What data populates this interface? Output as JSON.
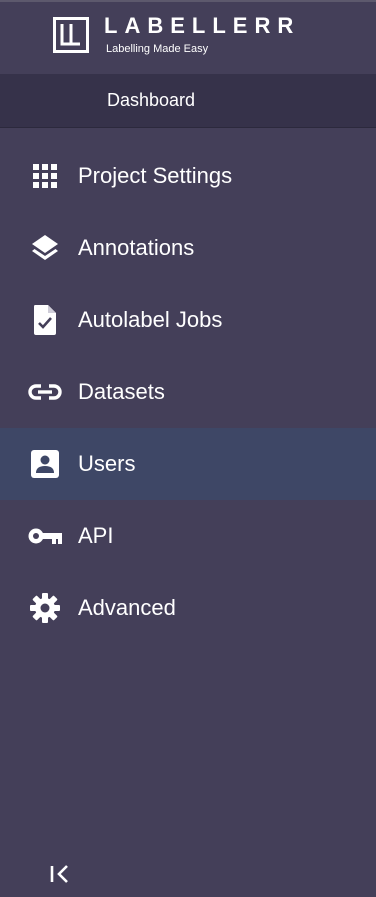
{
  "brand": {
    "name": "LABELLERR",
    "tagline": "Labelling Made Easy"
  },
  "dashboard": {
    "label": "Dashboard"
  },
  "nav": {
    "items": [
      {
        "label": "Project Settings",
        "icon": "grid-icon"
      },
      {
        "label": "Annotations",
        "icon": "layers-icon"
      },
      {
        "label": "Autolabel Jobs",
        "icon": "file-check-icon"
      },
      {
        "label": "Datasets",
        "icon": "link-icon"
      },
      {
        "label": "Users",
        "icon": "user-card-icon",
        "active": true
      },
      {
        "label": "API",
        "icon": "key-icon"
      },
      {
        "label": "Advanced",
        "icon": "gear-icon"
      }
    ]
  },
  "colors": {
    "sidebar_bg": "#443f59",
    "dashboard_bg": "#36324a",
    "active_bg": "#3e4766",
    "text": "#ffffff"
  },
  "collapse": {
    "icon": "collapse-left-icon"
  }
}
